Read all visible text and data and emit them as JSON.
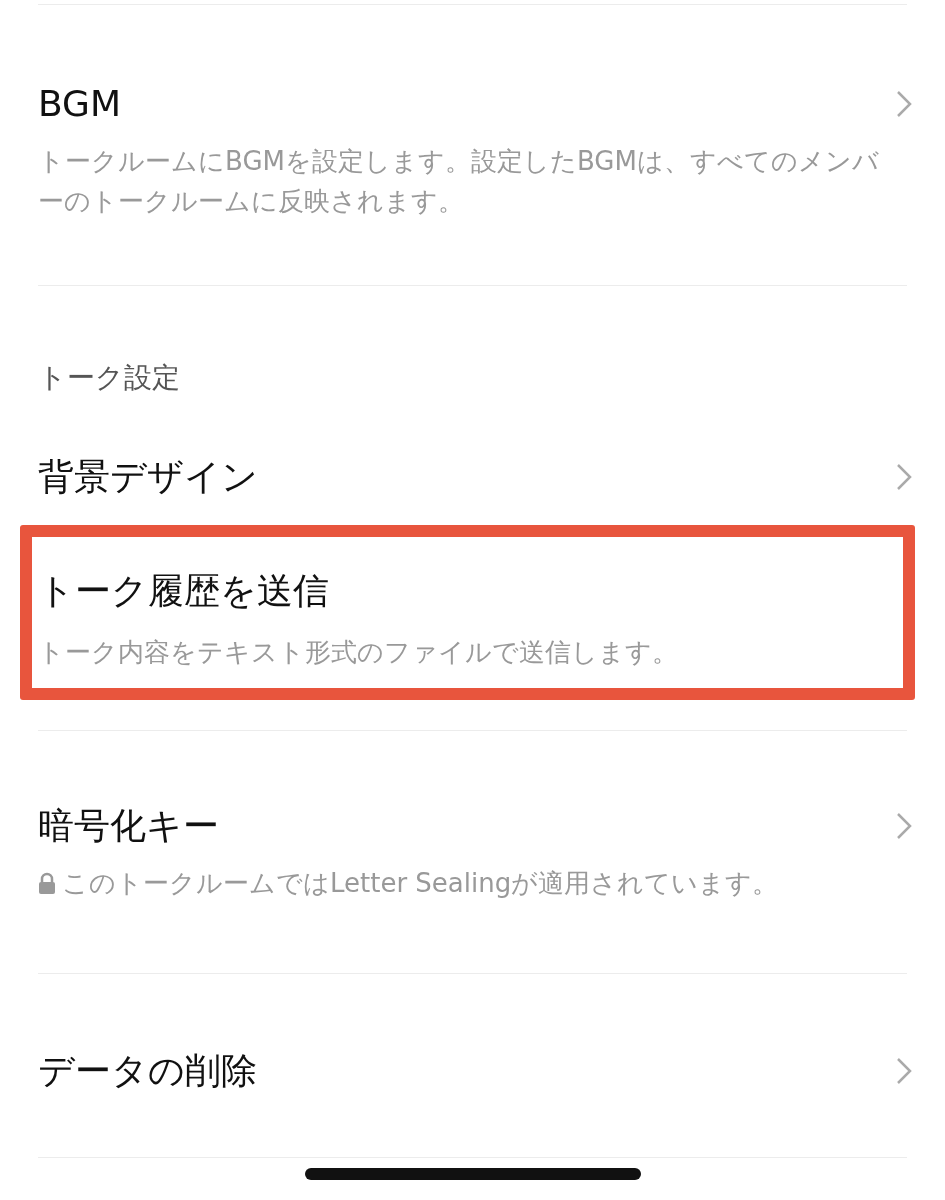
{
  "sections": [
    {
      "items": [
        {
          "title": "BGM",
          "description": "トークルームにBGMを設定します。設定したBGMは、すべてのメンバーのトークルームに反映されます。",
          "chevron": true
        }
      ]
    },
    {
      "header": "トーク設定",
      "items": [
        {
          "title": "背景デザイン",
          "chevron": true
        },
        {
          "title": "トーク履歴を送信",
          "description": "トーク内容をテキスト形式のファイルで送信します。",
          "highlighted": true
        },
        {
          "title": "暗号化キー",
          "description": "このトークルームではLetter Sealingが適用されています。",
          "chevron": true,
          "lock": true
        },
        {
          "title": "データの削除",
          "chevron": true
        }
      ]
    }
  ]
}
